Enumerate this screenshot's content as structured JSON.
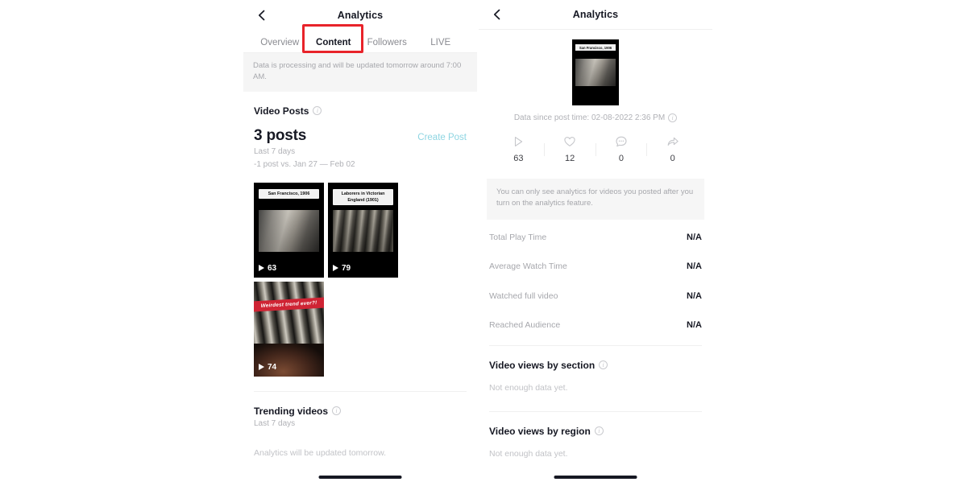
{
  "left_panel": {
    "nav": {
      "back_icon": "chevron-left-icon",
      "title": "Analytics"
    },
    "tabs": [
      {
        "label": "Overview",
        "active": false
      },
      {
        "label": "Content",
        "active": true
      },
      {
        "label": "Followers",
        "active": false
      },
      {
        "label": "LIVE",
        "active": false
      }
    ],
    "banner": "Data is processing and will be updated tomorrow around 7:00 AM.",
    "video_posts": {
      "title": "Video Posts",
      "info_icon": "info-circle-icon",
      "count": "3 posts",
      "create_post_label": "Create Post",
      "range": "Last 7 days",
      "comparison": "-1 post vs. Jan 27 — Feb 02",
      "videos": [
        {
          "caption": "San Francisco, 1906",
          "plays": "63",
          "play_icon": "play-icon"
        },
        {
          "caption": "Laborers in Victorian England (1901)",
          "plays": "79",
          "play_icon": "play-icon"
        },
        {
          "caption": "Weirdest trend ever?!",
          "plays": "74",
          "play_icon": "play-icon"
        }
      ]
    },
    "trending": {
      "title": "Trending videos",
      "info_icon": "info-circle-icon",
      "range": "Last 7 days",
      "empty": "Analytics will be updated tomorrow."
    }
  },
  "right_panel": {
    "nav": {
      "back_icon": "chevron-left-icon",
      "title": "Analytics"
    },
    "thumbnail_caption": "San Francisco, 1906",
    "since_text": "Data since post time: 02-08-2022 2:36 PM",
    "since_info_icon": "info-circle-icon",
    "stats": [
      {
        "icon": "play-icon",
        "value": "63"
      },
      {
        "icon": "heart-icon",
        "value": "12"
      },
      {
        "icon": "comment-icon",
        "value": "0"
      },
      {
        "icon": "share-icon",
        "value": "0"
      }
    ],
    "notice": "You can only see analytics for videos you posted after you turn on the analytics feature.",
    "metrics": [
      {
        "label": "Total Play Time",
        "value": "N/A"
      },
      {
        "label": "Average Watch Time",
        "value": "N/A"
      },
      {
        "label": "Watched full video",
        "value": "N/A"
      },
      {
        "label": "Reached Audience",
        "value": "N/A"
      }
    ],
    "views_by_section": {
      "title": "Video views by section",
      "info_icon": "info-circle-icon",
      "empty": "Not enough data yet."
    },
    "views_by_region": {
      "title": "Video views by region",
      "info_icon": "info-circle-icon",
      "empty": "Not enough data yet."
    }
  },
  "annotation": {
    "highlight_color": "#e8232a",
    "target": "Content"
  }
}
